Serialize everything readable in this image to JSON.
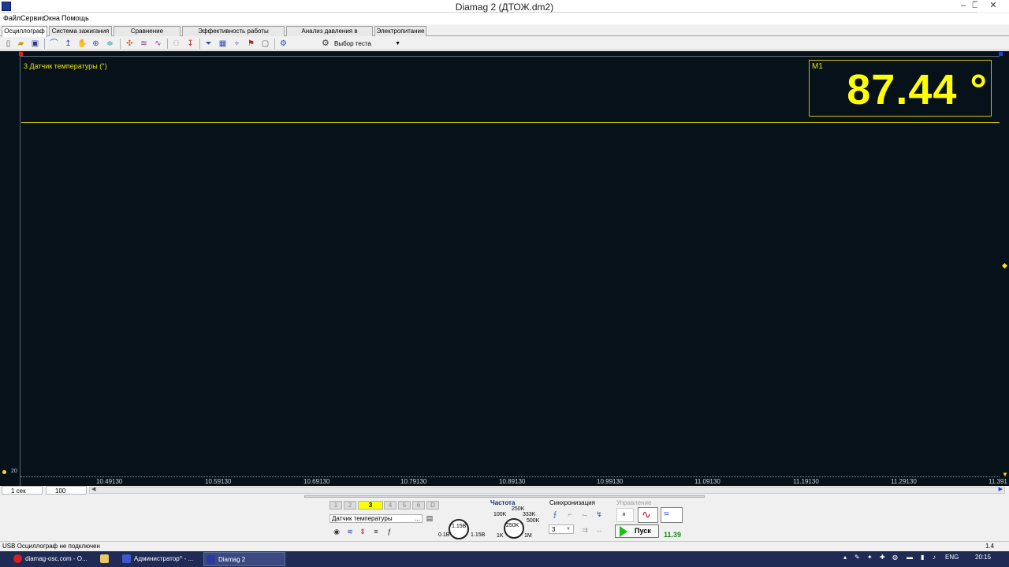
{
  "window": {
    "title": "Diamag 2 (ДТОЖ.dm2)",
    "minimize": "–",
    "restore": "❐",
    "close": "✕"
  },
  "menu": [
    "Файл",
    "Сервис",
    "Окна",
    "Помощь"
  ],
  "tabs": [
    {
      "label": "Осциллограф",
      "active": true
    },
    {
      "label": "Система зажигания",
      "active": false
    },
    {
      "label": "Сравнение цилиндров",
      "active": false
    },
    {
      "label": "Эффективность работы цилиндров",
      "active": false
    },
    {
      "label": "Анализ давления в цилиндре",
      "active": false
    },
    {
      "label": "Электропитание",
      "active": false
    }
  ],
  "toolbar": {
    "icons": [
      "new-file-icon",
      "open-folder-icon",
      "save-icon",
      "cursor-icon",
      "cursor-marker-icon",
      "hand-pan-icon",
      "zoom-icon",
      "auto-scale-icon",
      "center-icon",
      "waveform-icon",
      "compare-waveform-icon",
      "dim-icon",
      "set-zero-icon",
      "filter-icon",
      "grid-icon",
      "split-icon",
      "bookmark-icon",
      "page-icon",
      "capture-icon"
    ],
    "test_select_label": "Выбор теста"
  },
  "scope": {
    "channel_label": "3 Датчик температуры (°)",
    "measurement_label": "M1",
    "measurement_value": "87.44 °",
    "y_min_label": "20",
    "x_ticks": [
      "10.49130",
      "10.59130",
      "10.69130",
      "10.79130",
      "10.89130",
      "10.99130",
      "11.09130",
      "11.19130",
      "11.29130",
      "11.391"
    ],
    "trace_color": "#c8c200",
    "value_color": "#ffff00"
  },
  "timebase": {
    "period": "1 сек",
    "points": "100"
  },
  "channels": {
    "buttons": [
      "1",
      "2",
      "3",
      "4",
      "5",
      "6",
      "D"
    ],
    "active": "3",
    "sensor": "Датчик температуры",
    "sensor_more": "...",
    "range_value": "1.15В",
    "range_min": "0.1В",
    "range_max": "1.15В"
  },
  "frequency": {
    "title": "Частота",
    "value": "250K",
    "marks": [
      "100K",
      "250K",
      "333K",
      "500K",
      "1K",
      "1M"
    ]
  },
  "sync": {
    "title": "Синхронизация",
    "channel": "3"
  },
  "control": {
    "title": "Управление",
    "start_label": "Пуск",
    "value": "11.39"
  },
  "status": {
    "message": "USB Осциллограф не подключен",
    "right": "1.4"
  },
  "taskbar": {
    "tasks": [
      {
        "label": "diamag-osc.com - O...",
        "color": "#d02020"
      },
      {
        "label": "",
        "color": "#e8c860"
      },
      {
        "label": "Администратор^ - ...",
        "color": "#3a5ad0"
      },
      {
        "label": "Diamag 2",
        "color": "#2a3aa0"
      }
    ],
    "lang": "ENG",
    "time": "20:15"
  }
}
